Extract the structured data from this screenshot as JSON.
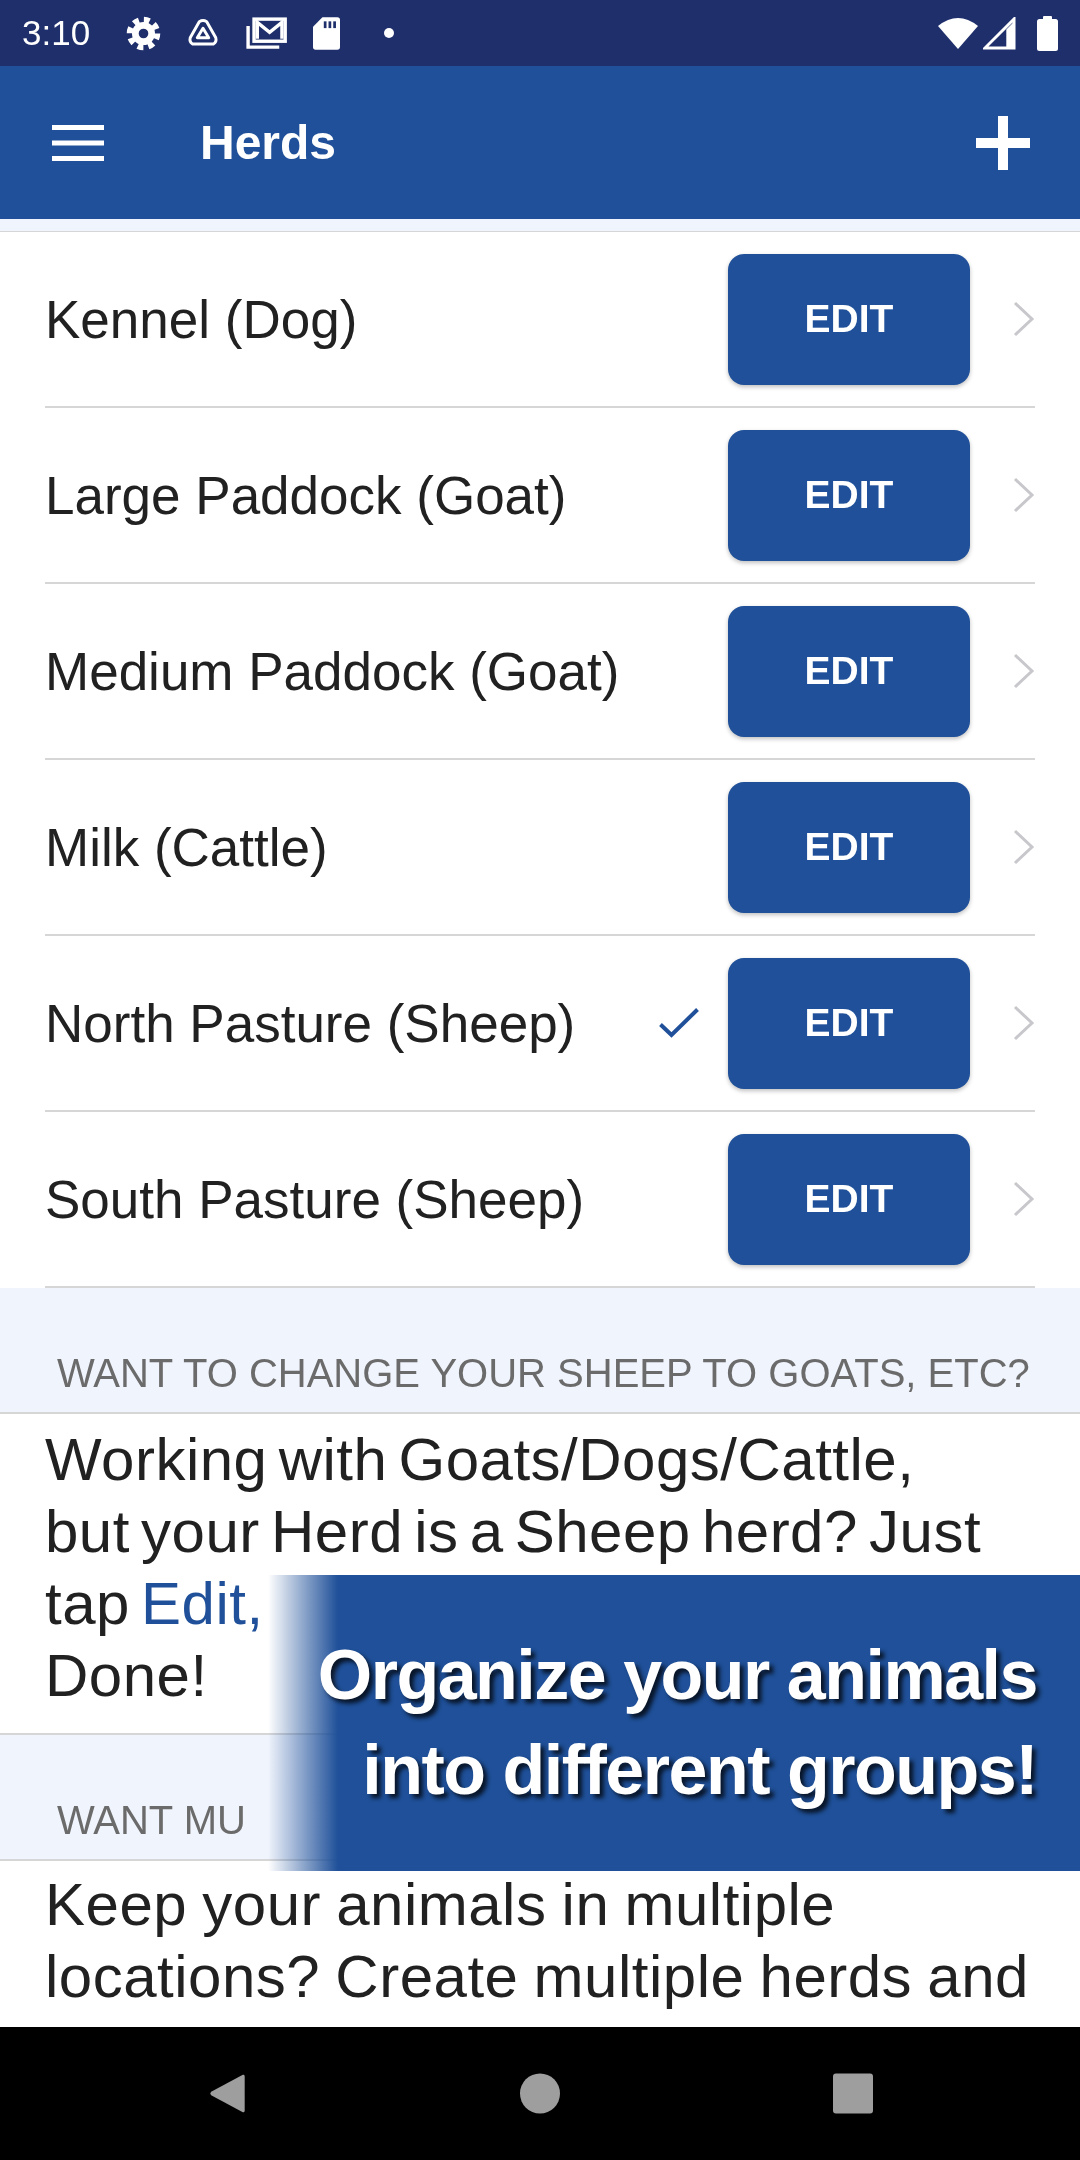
{
  "status_bar": {
    "time": "3:10"
  },
  "app_bar": {
    "title": "Herds"
  },
  "herds": [
    {
      "name": "Kennel (Dog)",
      "selected": false,
      "button": "EDIT"
    },
    {
      "name": "Large Paddock (Goat)",
      "selected": false,
      "button": "EDIT"
    },
    {
      "name": "Medium Paddock (Goat)",
      "selected": false,
      "button": "EDIT"
    },
    {
      "name": "Milk (Cattle)",
      "selected": false,
      "button": "EDIT"
    },
    {
      "name": "North Pasture (Sheep)",
      "selected": true,
      "button": "EDIT"
    },
    {
      "name": "South Pasture (Sheep)",
      "selected": false,
      "button": "EDIT"
    }
  ],
  "sections": [
    {
      "header": "WANT TO CHANGE YOUR SHEEP TO GOATS, ETC?",
      "text": "Working with Goats/Dogs/Cattle, but your Herd is a Sheep herd? Just tap",
      "link": "Edit,",
      "after": "Done!"
    },
    {
      "header": "WANT MU",
      "text": "Keep your animals in multiple locations? Create multiple herds and"
    }
  ],
  "promo_banner": {
    "text": "Organize your animals into different groups!"
  }
}
